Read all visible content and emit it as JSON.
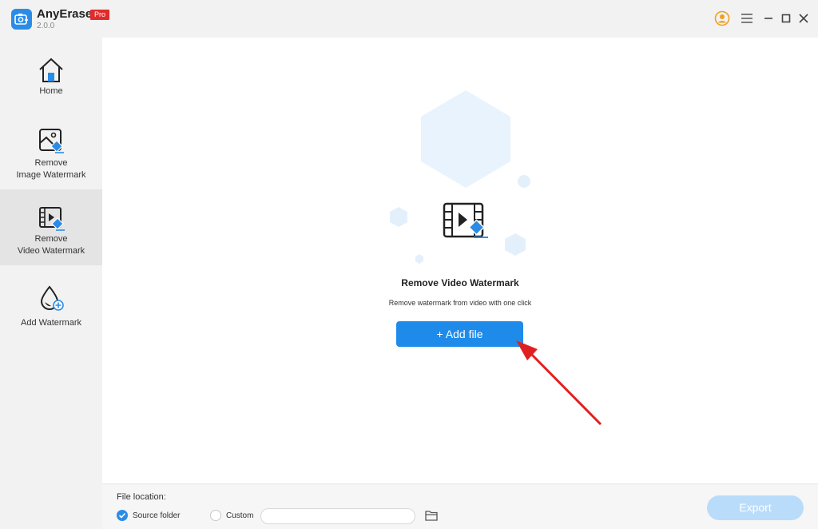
{
  "app": {
    "name": "AnyErase",
    "version": "2.0.0",
    "badge": "Pro"
  },
  "window_controls": {
    "icons": [
      "account-icon",
      "menu-icon",
      "minimize-icon",
      "maximize-icon",
      "close-icon"
    ]
  },
  "sidebar": {
    "items": [
      {
        "label_line1": "Home",
        "label_line2": "",
        "icon": "home-icon",
        "active": false
      },
      {
        "label_line1": "Remove",
        "label_line2": "Image Watermark",
        "icon": "image-eraser-icon",
        "active": false
      },
      {
        "label_line1": "Remove",
        "label_line2": "Video Watermark",
        "icon": "video-eraser-icon",
        "active": true
      },
      {
        "label_line1": "Add Watermark",
        "label_line2": "",
        "icon": "drop-add-icon",
        "active": false
      }
    ]
  },
  "main": {
    "hero_icon": "video-eraser-icon",
    "title": "Remove Video Watermark",
    "subtitle": "Remove watermark from video with one click",
    "add_file_label": "+ Add file"
  },
  "bottom": {
    "file_location_label": "File location:",
    "options": [
      {
        "label": "Source folder",
        "checked": true
      },
      {
        "label": "Custom",
        "checked": false
      }
    ],
    "custom_path_value": "",
    "export_label": "Export",
    "export_enabled": false
  },
  "colors": {
    "accent": "#1e8bea",
    "badge_red": "#e12b2b",
    "export_disabled": "#b9dcfa",
    "annotation_arrow": "#e02020"
  }
}
